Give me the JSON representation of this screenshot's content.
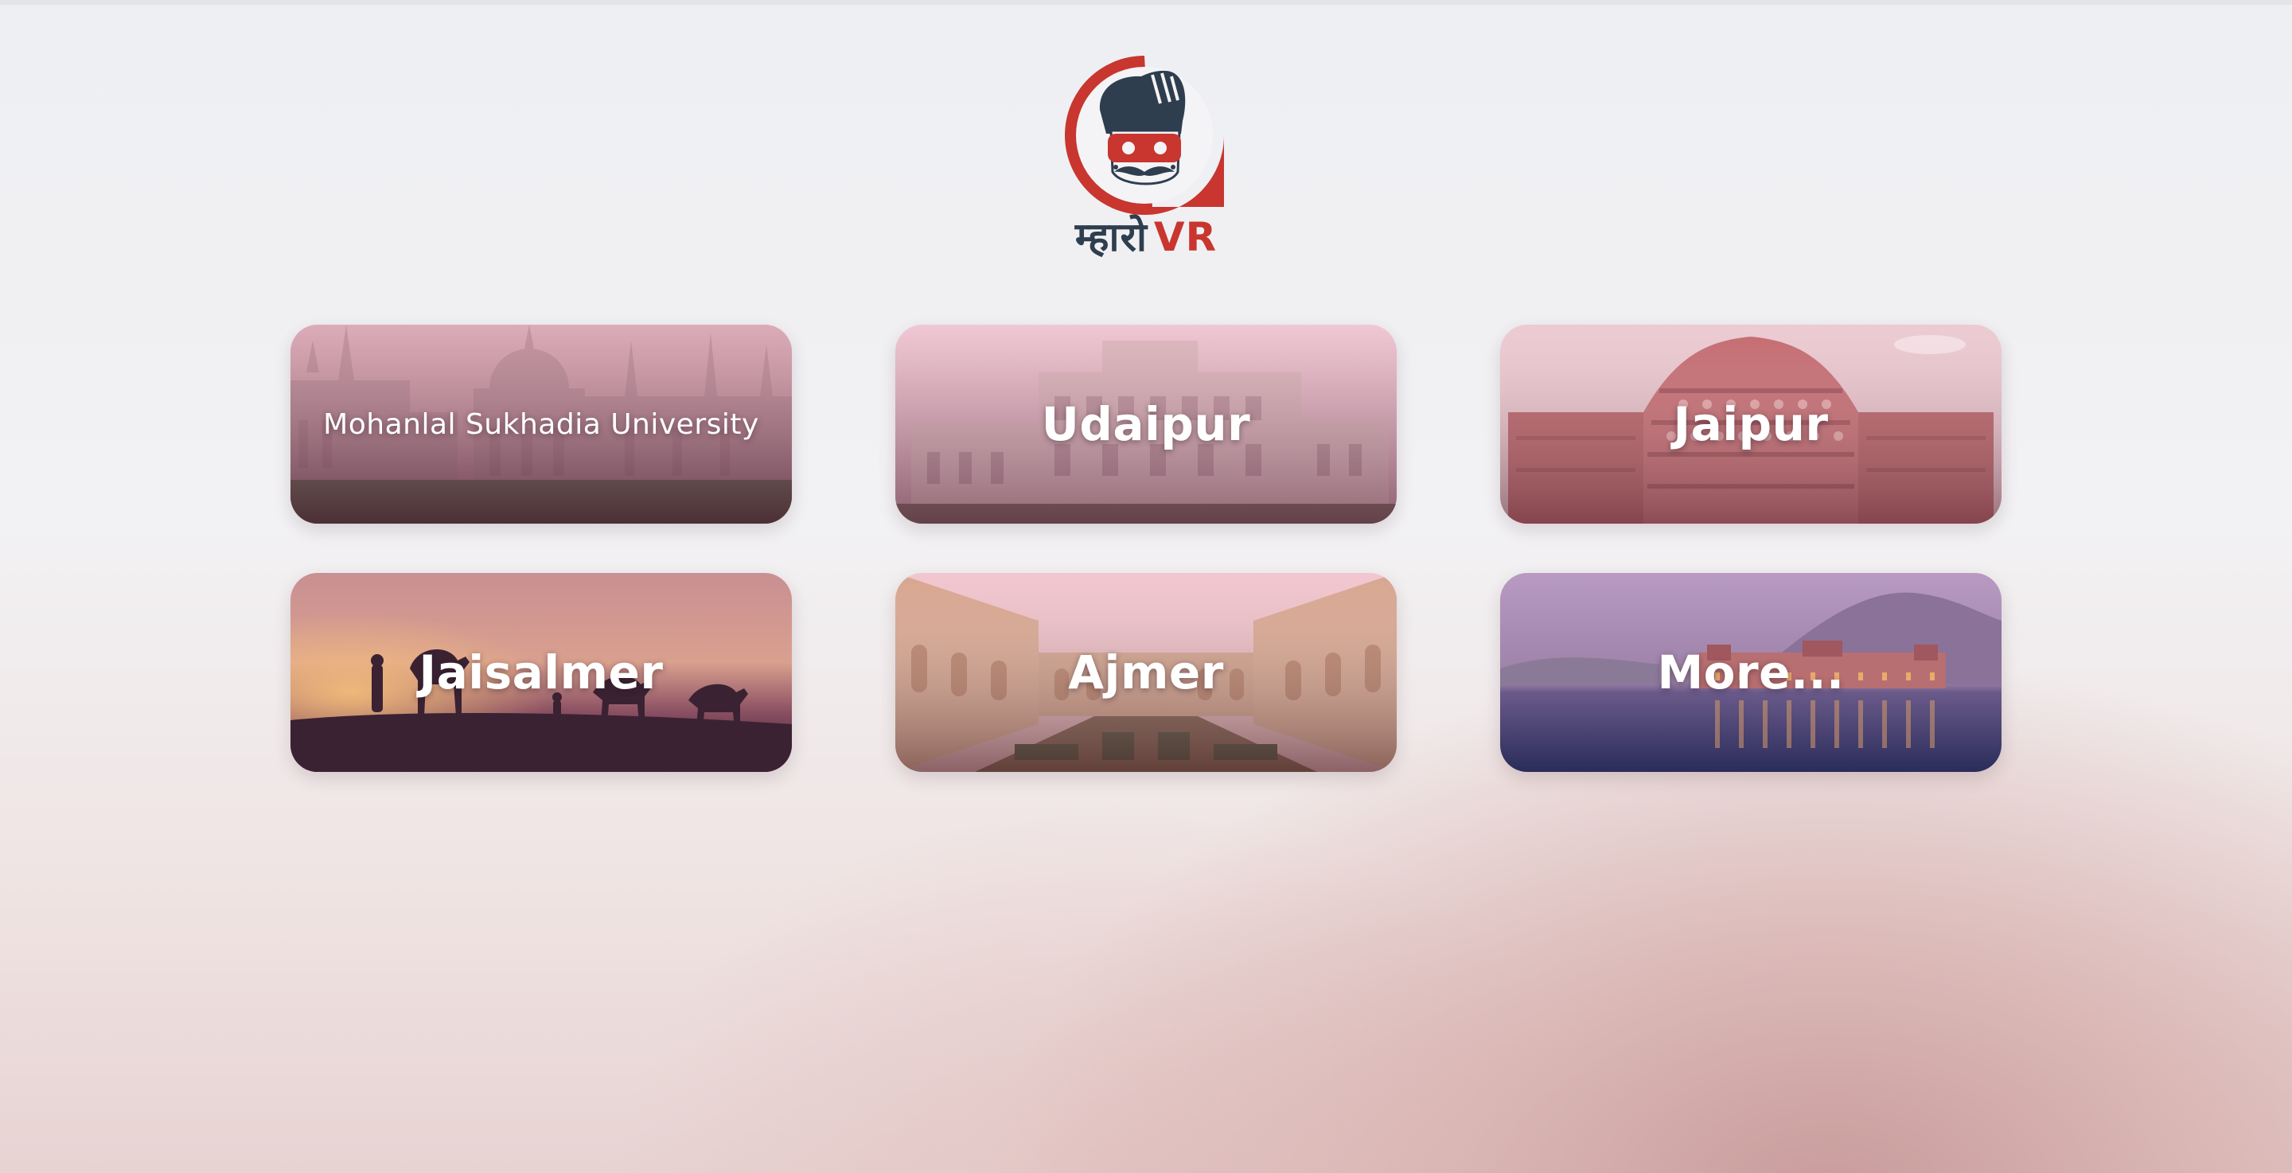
{
  "brand": {
    "word_hindi": "म्हारो",
    "word_latin": "VR",
    "colors": {
      "red": "#c8362f",
      "navy": "#2e3e4e"
    }
  },
  "destinations": [
    {
      "label": "Mohanlal Sukhadia University",
      "icon": "university-photo"
    },
    {
      "label": "Udaipur",
      "icon": "palace-photo"
    },
    {
      "label": "Jaipur",
      "icon": "hawa-mahal-photo"
    },
    {
      "label": "Jaisalmer",
      "icon": "desert-camels-photo"
    },
    {
      "label": "Ajmer",
      "icon": "fort-courtyard-photo"
    },
    {
      "label": "More...",
      "icon": "lake-palace-photo"
    }
  ]
}
